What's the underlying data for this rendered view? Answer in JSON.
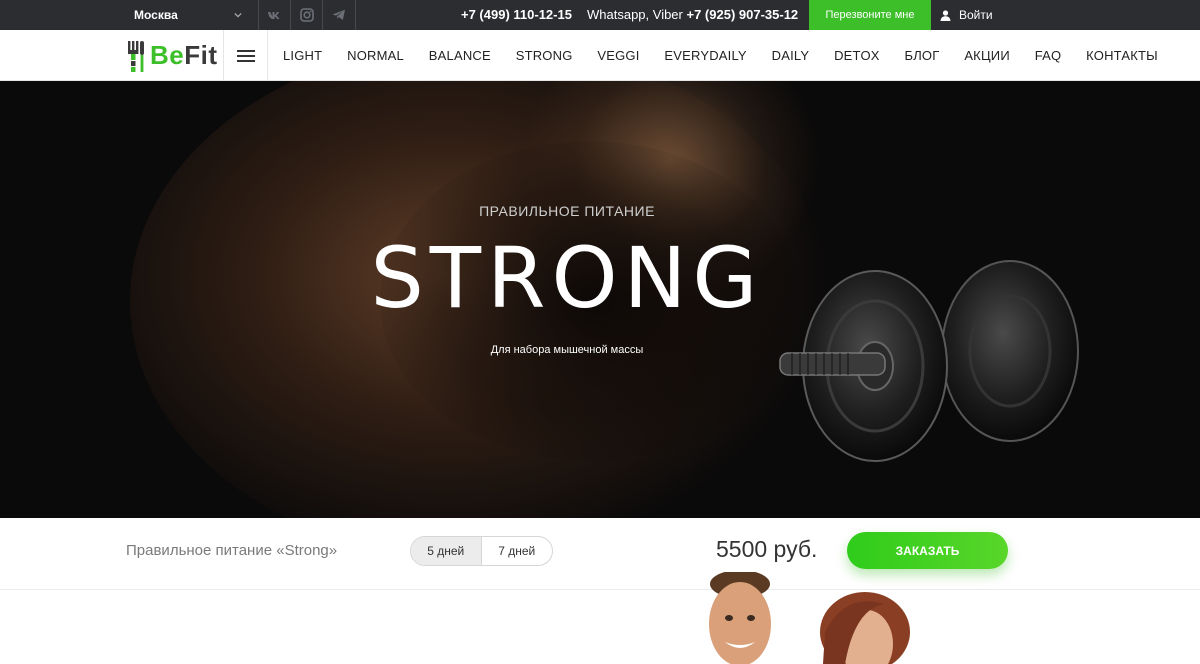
{
  "topbar": {
    "city": "Москва",
    "socials": [
      "vk-icon",
      "instagram-icon",
      "telegram-icon"
    ],
    "phone": "+7 (499) 110-12-15",
    "messenger_label": "Whatsapp, Viber",
    "messenger_phone": "+7 (925) 907-35-12",
    "callback_label": "Перезвоните мне",
    "login_label": "Войти"
  },
  "logo": {
    "part1": "Be",
    "part2": "Fit"
  },
  "nav": {
    "items": [
      "LIGHT",
      "NORMAL",
      "BALANCE",
      "STRONG",
      "VEGGI",
      "EVERYDAILY",
      "DAILY",
      "DETOX",
      "БЛОГ",
      "АКЦИИ",
      "FAQ",
      "КОНТАКТЫ"
    ]
  },
  "hero": {
    "subtitle": "ПРАВИЛЬНОЕ ПИТАНИЕ",
    "title": "STRONG",
    "description": "Для набора мышечной массы"
  },
  "order": {
    "product_name": "Правильное питание «Strong»",
    "day_options": [
      "5 дней",
      "7 дней"
    ],
    "selected_days": "5 дней",
    "price": "5500 руб.",
    "order_label": "ЗАКАЗАТЬ"
  },
  "colors": {
    "accent_green": "#3dbf2a",
    "topbar_bg": "#2b2d31"
  }
}
